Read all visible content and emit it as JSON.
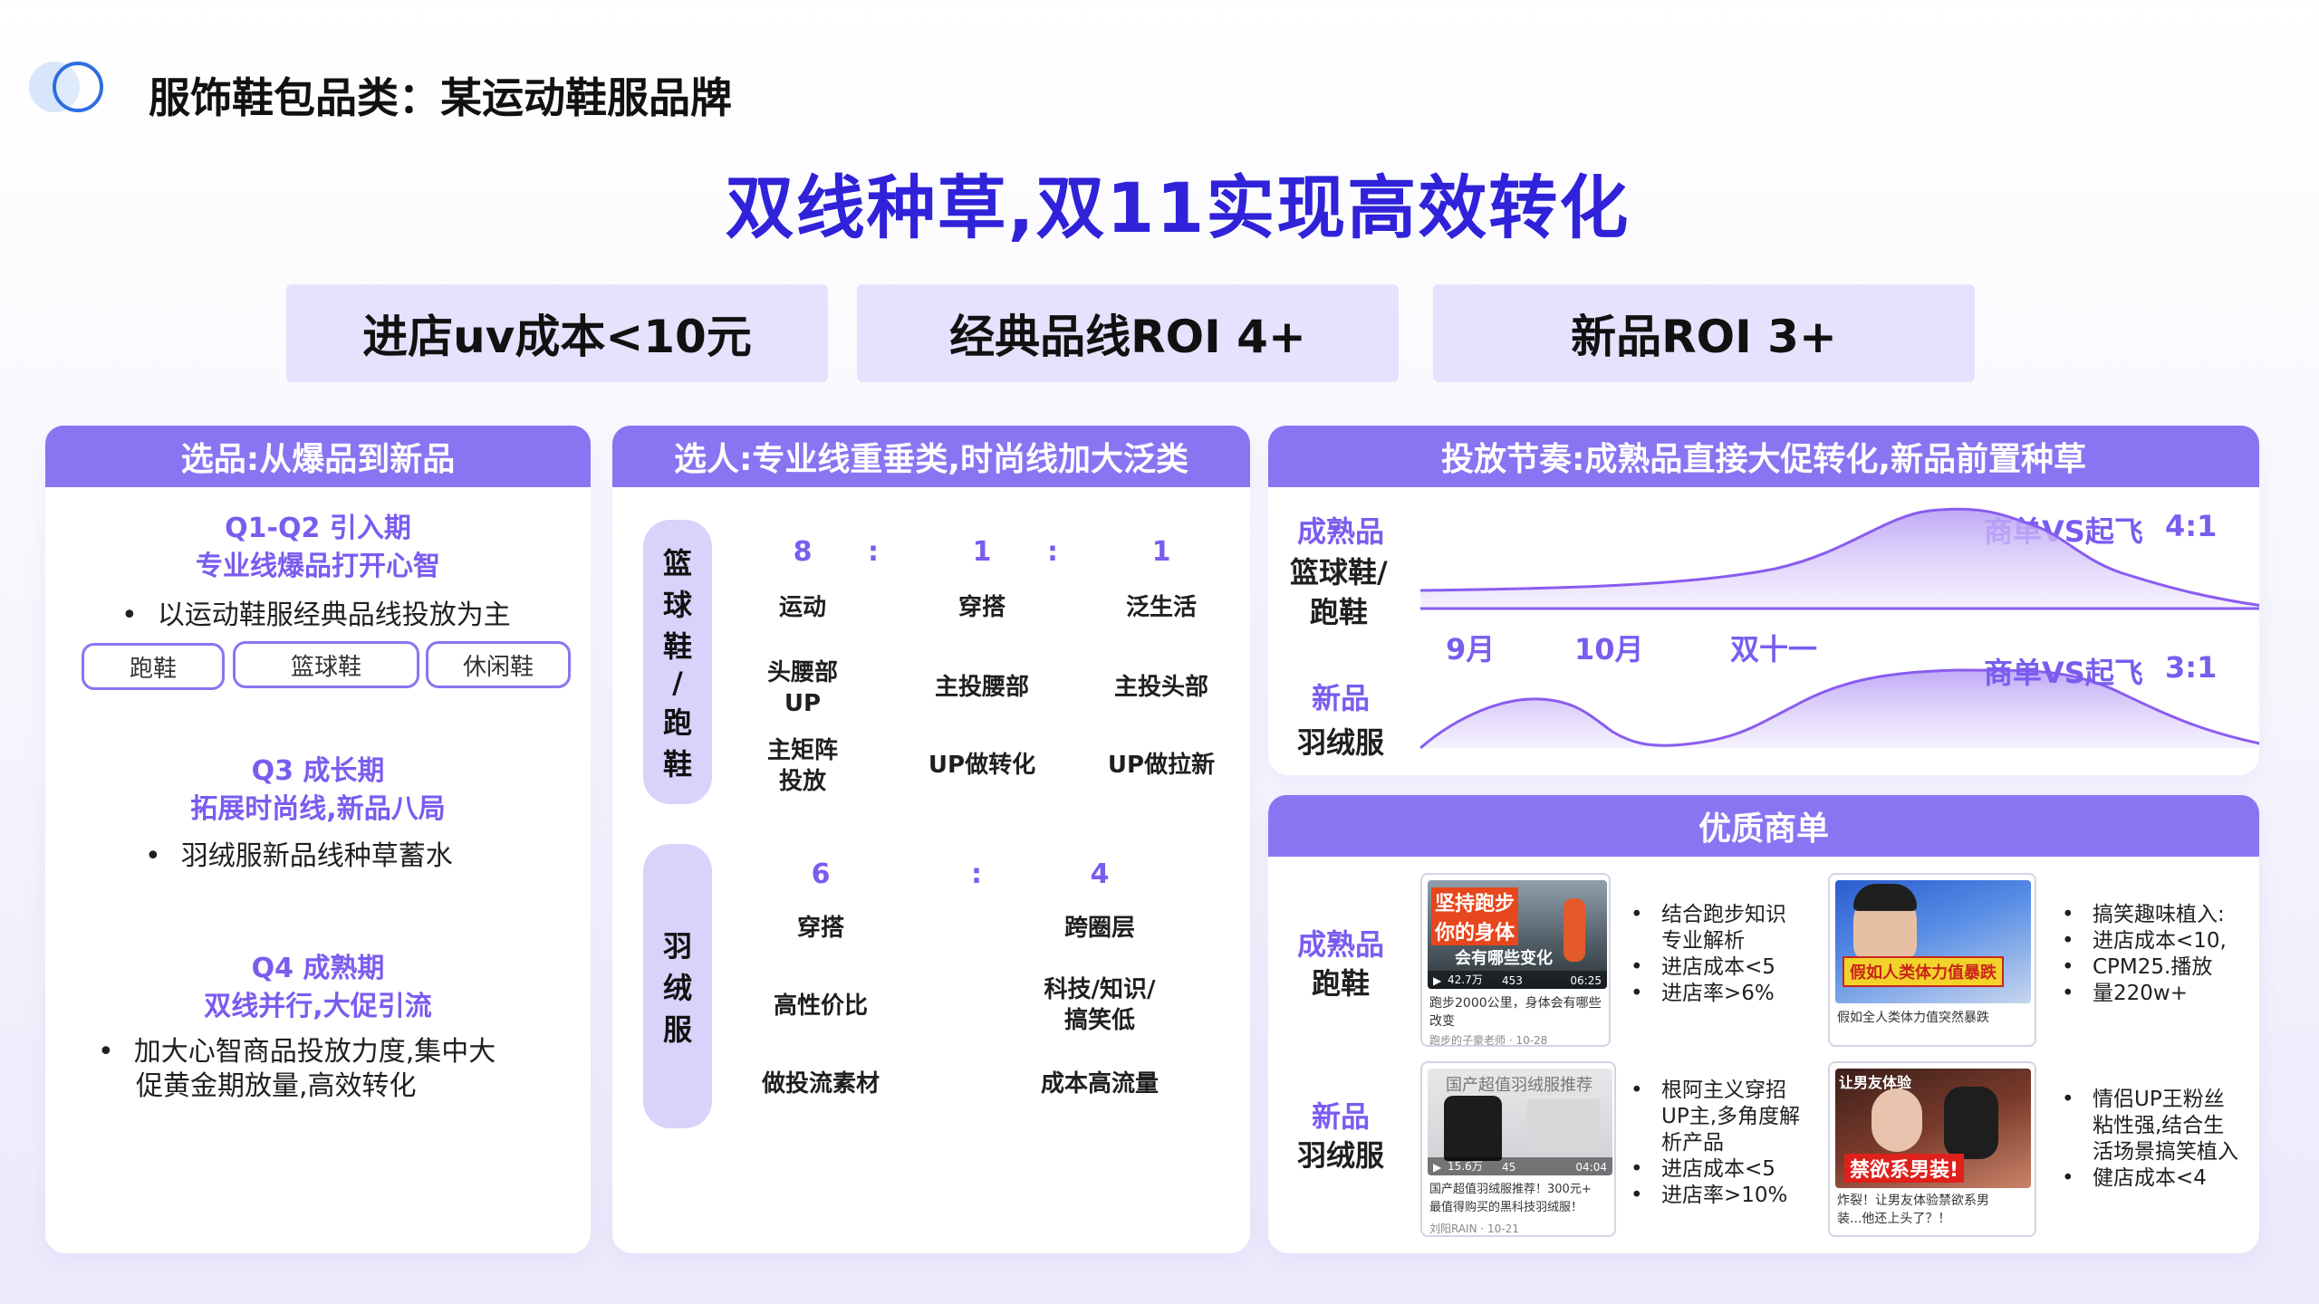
{
  "header": {
    "section_title": "服饰鞋包品类：某运动鞋服品牌",
    "main_title": "双线种草,双11实现高效转化"
  },
  "kpis": [
    "进店uv成本<10元",
    "经典品线ROI 4+",
    "新品ROI 3+"
  ],
  "left_panel": {
    "title": "选品:从爆品到新品",
    "q1": {
      "period": "Q1-Q2 引入期",
      "subtitle": "专业线爆品打开心智",
      "bullet": "以运动鞋服经典品线投放为主",
      "pills": [
        "跑鞋",
        "篮球鞋",
        "休闲鞋"
      ]
    },
    "q3": {
      "period": "Q3 成长期",
      "subtitle": "拓展时尚线,新品八局",
      "bullet": "羽绒服新品线种草蓄水"
    },
    "q4": {
      "period": "Q4 成熟期",
      "subtitle": "双线并行,大促引流",
      "bullet_line1": "加大心智商品投放力度,集中大",
      "bullet_line2": "促黄金期放量,高效转化"
    }
  },
  "middle_panel": {
    "title": "选人:专业线重垂类,时尚线加大泛类",
    "group1": {
      "category": [
        "篮",
        "球",
        "鞋",
        "/",
        "跑",
        "鞋"
      ],
      "ratio": [
        "8",
        ":",
        "1",
        ":",
        "1"
      ],
      "columns": [
        {
          "type": "运动",
          "row2": [
            "头腰部",
            "UP"
          ],
          "row3": [
            "主矩阵",
            "投放"
          ]
        },
        {
          "type": "穿搭",
          "row2": [
            "主投腰部"
          ],
          "row3": [
            "UP做转化"
          ]
        },
        {
          "type": "泛生活",
          "row2": [
            "主投头部"
          ],
          "row3": [
            "UP做拉新"
          ]
        }
      ]
    },
    "group2": {
      "category": [
        "羽",
        "绒",
        "服"
      ],
      "ratio": [
        "6",
        ":",
        "4"
      ],
      "columns": [
        {
          "type": "穿搭",
          "row2": [
            "高性价比"
          ],
          "row3": [
            "做投流素材"
          ]
        },
        {
          "type": "跨圈层",
          "row2": [
            "科技/知识/",
            "搞笑低"
          ],
          "row3": [
            "成本高流量"
          ]
        }
      ]
    }
  },
  "rhythm_panel": {
    "title": "投放节奏:成熟品直接大促转化,新品前置种草",
    "row1": {
      "label_purple": "成熟品",
      "label_black": [
        "篮球鞋/",
        "跑鞋"
      ],
      "ratio_label": "商单VS起飞",
      "ratio_value": "4:1"
    },
    "axis": [
      "9月",
      "10月",
      "双十一"
    ],
    "row2": {
      "label_purple": "新品",
      "label_black": [
        "羽绒服"
      ],
      "ratio_label": "商单VS起飞",
      "ratio_value": "3:1"
    },
    "colors": {
      "curve": "#8a5cf0",
      "fill": "#cbb7f8"
    }
  },
  "quality_panel": {
    "title": "优质商单",
    "rows": [
      {
        "label_purple": "成熟品",
        "label_black": "跑鞋",
        "video1": {
          "overlay": [
            "坚持跑步",
            "你的身体",
            "会有哪些变化"
          ],
          "stats": [
            "42.7万",
            "453",
            "06:25"
          ],
          "caption": [
            "跑步2000公里，身体会有哪些",
            "改变"
          ],
          "author": "跑步的子豪老师 · 10-28"
        },
        "notes1": [
          "结合跑步知识",
          "专业解析",
          "进店成本<5",
          "进店率>6%"
        ],
        "notes1_lines": [
          [
            "结合跑步知识",
            "专业解析"
          ],
          [
            "进店成本<5"
          ],
          [
            "进店率>6%"
          ]
        ],
        "video2": {
          "overlay": [
            "假如人类体力值暴跌"
          ],
          "caption": [
            "假如全人类体力值突然暴跌"
          ]
        },
        "notes2_lines": [
          [
            "搞笑趣味植入:"
          ],
          [
            "进店成本<10,"
          ],
          [
            "CPM25.播放"
          ],
          [
            "量220w+"
          ]
        ]
      },
      {
        "label_purple": "新品",
        "label_black": "羽绒服",
        "video1": {
          "overlay": [
            "国产超值羽绒服推荐"
          ],
          "stats": [
            "15.6万",
            "45",
            "04:04"
          ],
          "caption": [
            "国产超值羽绒服推荐！300元+",
            "最值得购买的黑科技羽绒服！"
          ],
          "author": "刘阳RAIN · 10-21"
        },
        "notes1_lines": [
          [
            "根阿主义穿招",
            "UP主,多角度解",
            "析产品"
          ],
          [
            "进店成本<5"
          ],
          [
            "进店率>10%"
          ]
        ],
        "video2": {
          "overlay": [
            "让男友体验",
            "禁欲系男装!"
          ],
          "caption": [
            "炸裂！让男友体验禁欲系男",
            "装...他还上头了？！"
          ]
        },
        "notes2_lines": [
          [
            "情侣UP王粉丝",
            "粘性强,结合生",
            "活场景搞笑植入"
          ],
          [
            "健店成本<4"
          ]
        ]
      }
    ]
  },
  "colors": {
    "accent": "#7a5cf0",
    "header": "#8a74f2",
    "title": "#2f22d9",
    "kpi_bg": "#e6e1fc"
  }
}
